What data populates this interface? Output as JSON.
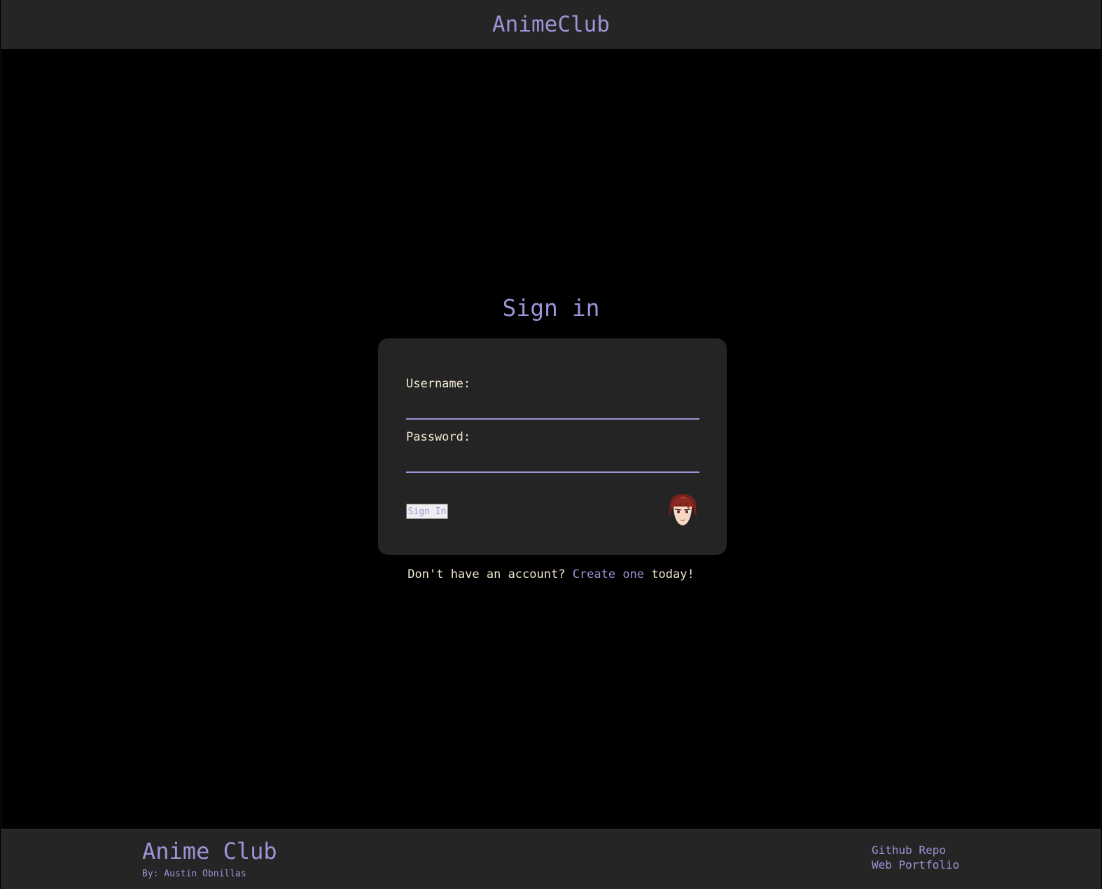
{
  "header": {
    "title": "AnimeClub"
  },
  "signin": {
    "title": "Sign in",
    "username_label": "Username:",
    "username_value": "",
    "password_label": "Password:",
    "password_value": "",
    "button_label": "Sign In",
    "avatar_icon": "anime-character-avatar-icon"
  },
  "account": {
    "prefix": "Don't have an account? ",
    "link_label": "Create one",
    "suffix": " today!"
  },
  "footer": {
    "brand": "Anime Club",
    "author": "By: Austin Obnillas",
    "links": [
      {
        "label": "Github Repo"
      },
      {
        "label": "Web Portfolio"
      }
    ]
  },
  "colors": {
    "accent": "#9b94d6",
    "text": "#f3ead2",
    "panel": "#242424",
    "background": "#000000"
  }
}
